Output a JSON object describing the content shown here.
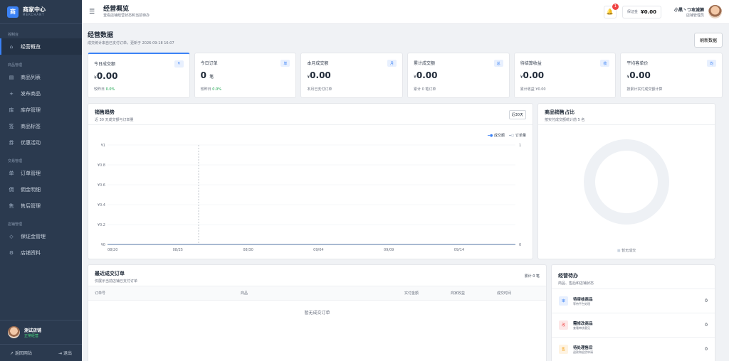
{
  "brand": {
    "logo": "商",
    "title": "商家中心",
    "sub": "MERCHANT"
  },
  "nav": {
    "groups": [
      {
        "label": "控制台",
        "items": [
          {
            "icon": "⌂",
            "label": "经营概览",
            "active": true
          }
        ]
      },
      {
        "label": "商品管理",
        "items": [
          {
            "icon": "▤",
            "label": "商品列表"
          },
          {
            "icon": "+",
            "label": "发布商品"
          },
          {
            "icon": "库",
            "label": "库存管理"
          },
          {
            "icon": "签",
            "label": "商品标签"
          },
          {
            "icon": "券",
            "label": "优惠活动"
          }
        ]
      },
      {
        "label": "交易管理",
        "items": [
          {
            "icon": "单",
            "label": "订单管理"
          },
          {
            "icon": "佣",
            "label": "佣金明细"
          },
          {
            "icon": "售",
            "label": "售后管理"
          }
        ]
      },
      {
        "label": "店铺管理",
        "items": [
          {
            "icon": "◇",
            "label": "保证金管理"
          },
          {
            "icon": "⚙",
            "label": "店铺资料"
          }
        ]
      }
    ]
  },
  "store": {
    "name": "测试店铺",
    "status": "正常经营"
  },
  "footer": {
    "back": "↗ 返回网站",
    "logout": "⇥ 退出"
  },
  "topbar": {
    "menu": "☰",
    "title": "经营概览",
    "sub": "查看店铺经营状态和当前待办",
    "bell": "🔔",
    "badge": "1",
    "deposit_label": "保证金",
    "deposit_value": "¥0.00",
    "user_name": "小黑丶つ攻城狮",
    "user_role": "店铺管理员"
  },
  "page": {
    "title": "经营数据",
    "sub": "成交统计来自已支付订单，更新于 2026-09-18 16:07",
    "refresh": "刷新数据"
  },
  "stats": [
    {
      "label": "今日成交额",
      "tag": "¥",
      "prefix": "¥",
      "value": "0.00",
      "unit": "",
      "foot": "较昨日",
      "foot_up": "0.0%"
    },
    {
      "label": "今日订单",
      "tag": "单",
      "prefix": "",
      "value": "0",
      "unit": "笔",
      "foot": "较昨日",
      "foot_up": "0.0%"
    },
    {
      "label": "本月成交额",
      "tag": "月",
      "prefix": "¥",
      "value": "0.00",
      "unit": "",
      "foot": "本月已支付订单",
      "foot_up": ""
    },
    {
      "label": "累计成交额",
      "tag": "总",
      "prefix": "¥",
      "value": "0.00",
      "unit": "",
      "foot": "累计 0 笔订单",
      "foot_up": ""
    },
    {
      "label": "待结算收益",
      "tag": "收",
      "prefix": "¥",
      "value": "0.00",
      "unit": "",
      "foot": "累计收益 ¥0.00",
      "foot_up": ""
    },
    {
      "label": "平均客单价",
      "tag": "均",
      "prefix": "¥",
      "value": "0.00",
      "unit": "",
      "foot": "按累计实付成交额计算",
      "foot_up": ""
    }
  ],
  "sales": {
    "title": "销售趋势",
    "sub": "近 30 天成交额与订单量",
    "range": "近30天",
    "legend_amount": "成交额",
    "legend_orders": "订单量"
  },
  "chart_data": {
    "type": "line",
    "x": [
      "08/20",
      "08/25",
      "08/30",
      "09/04",
      "09/09",
      "09/14"
    ],
    "y_left_ticks": [
      "¥0",
      "¥0.2",
      "¥0.4",
      "¥0.6",
      "¥0.8",
      "¥1"
    ],
    "y_right_ticks": [
      "0",
      "1"
    ],
    "series": [
      {
        "name": "成交额",
        "color": "#3b82f6",
        "values": [
          0,
          0,
          0,
          0,
          0,
          0
        ]
      },
      {
        "name": "订单量",
        "color": "#94a3b8",
        "values": [
          0,
          0,
          0,
          0,
          0,
          0
        ]
      }
    ],
    "ylim": [
      0,
      1
    ],
    "grid": true,
    "legend": "top-right"
  },
  "share": {
    "title": "商品销售占比",
    "sub": "按实付成交额统计前 5 名",
    "empty": "暂无成交"
  },
  "orders": {
    "title": "最近成交订单",
    "sub": "仅展示当前店铺已支付订单",
    "total": "累计 0 笔",
    "cols": [
      "订单号",
      "商品",
      "实付金额",
      "商家收益",
      "成交时间"
    ],
    "empty": "暂无成交订单"
  },
  "todo": {
    "title": "经营待办",
    "sub": "商品、售后和店铺状态",
    "items": [
      {
        "icon": "审",
        "color": "#3b82f6",
        "bg": "#e8f0fe",
        "title": "待审核商品",
        "sub": "等待平台处理",
        "count": "0"
      },
      {
        "icon": "改",
        "color": "#ef4444",
        "bg": "#fde8e8",
        "title": "需修改商品",
        "sub": "查看审核意见",
        "count": "0"
      },
      {
        "icon": "售",
        "color": "#f59e0b",
        "bg": "#fef3e2",
        "title": "待处理售后",
        "sub": "退款和退货申请",
        "count": "0"
      }
    ]
  }
}
